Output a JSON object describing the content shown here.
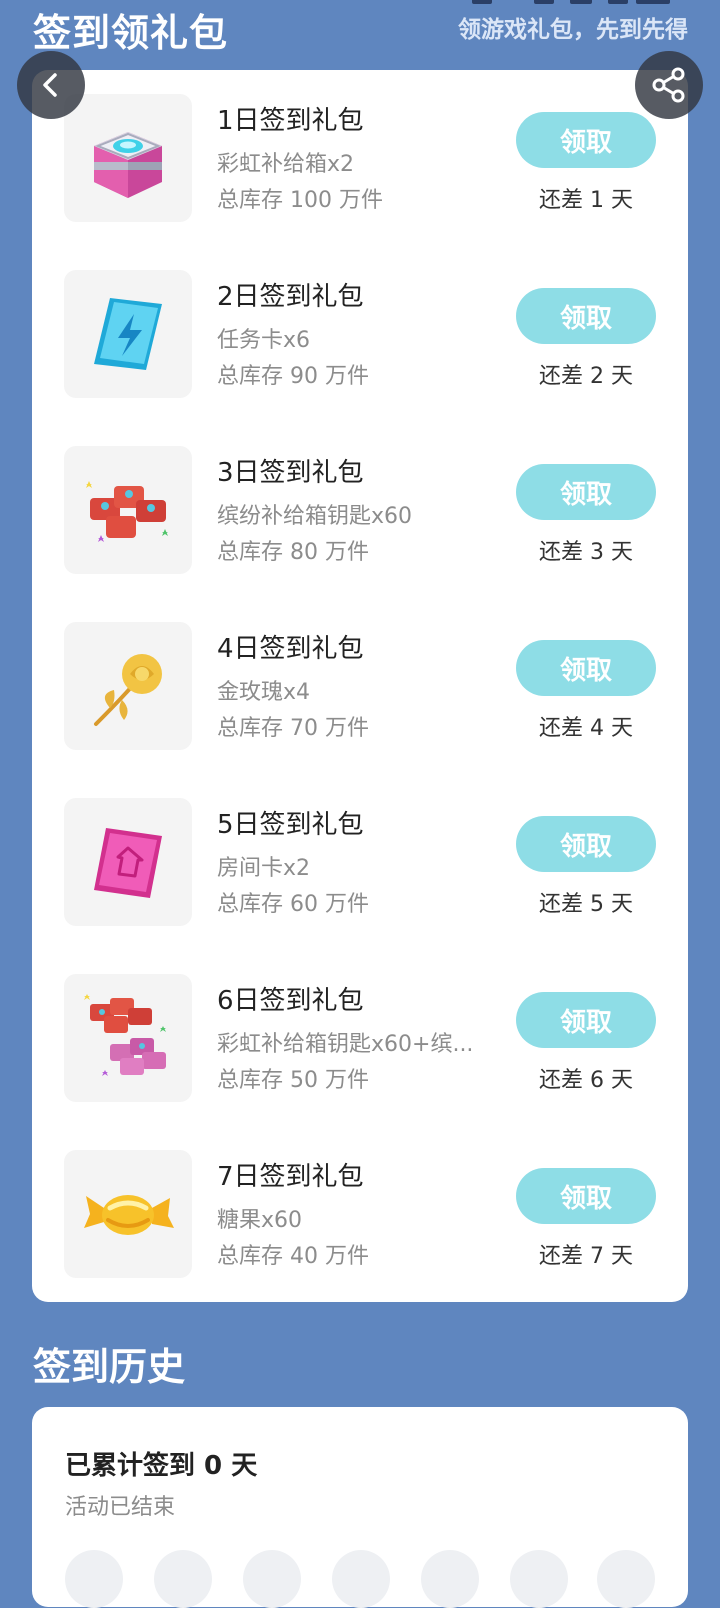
{
  "header": {
    "title": "签到领礼包",
    "subtitle": "领游戏礼包，先到先得"
  },
  "gifts": [
    {
      "name": "1日签到礼包",
      "content": "彩虹补给箱x2",
      "stock": "总库存 100 万件",
      "button": "领取",
      "days_left": "还差 1 天",
      "icon": "rainbow-supply-box-icon"
    },
    {
      "name": "2日签到礼包",
      "content": "任务卡x6",
      "stock": "总库存 90 万件",
      "button": "领取",
      "days_left": "还差 2 天",
      "icon": "task-card-icon"
    },
    {
      "name": "3日签到礼包",
      "content": "缤纷补给箱钥匙x60",
      "stock": "总库存 80 万件",
      "button": "领取",
      "days_left": "还差 3 天",
      "icon": "colorful-box-keys-icon"
    },
    {
      "name": "4日签到礼包",
      "content": "金玫瑰x4",
      "stock": "总库存 70 万件",
      "button": "领取",
      "days_left": "还差 4 天",
      "icon": "golden-rose-icon"
    },
    {
      "name": "5日签到礼包",
      "content": "房间卡x2",
      "stock": "总库存 60 万件",
      "button": "领取",
      "days_left": "还差 5 天",
      "icon": "room-card-icon"
    },
    {
      "name": "6日签到礼包",
      "content": "彩虹补给箱钥匙x60+缤...",
      "stock": "总库存 50 万件",
      "button": "领取",
      "days_left": "还差 6 天",
      "icon": "mixed-keys-icon"
    },
    {
      "name": "7日签到礼包",
      "content": "糖果x60",
      "stock": "总库存 40 万件",
      "button": "领取",
      "days_left": "还差 7 天",
      "icon": "candy-icon"
    }
  ],
  "history": {
    "section_title": "签到历史",
    "total": "已累计签到 0 天",
    "status": "活动已结束"
  },
  "colors": {
    "background": "#5f86bf",
    "button": "#8edde6",
    "card": "#ffffff"
  }
}
